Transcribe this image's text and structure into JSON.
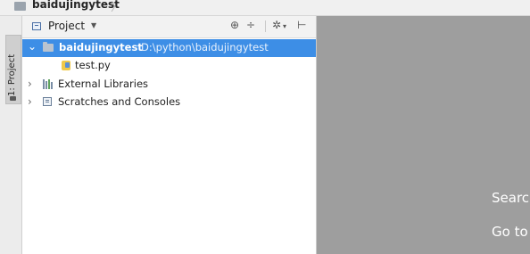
{
  "navbar": {
    "crumb": "baidujingytest"
  },
  "toolwindow_stripe": {
    "tab_label": "1: Project"
  },
  "project_panel": {
    "header": {
      "view_label": "Project"
    },
    "tree": [
      {
        "name": "baidujingytest",
        "path": "D:\\python\\baidujingytest",
        "expanded": true,
        "selected": true,
        "icon": "folder-icon"
      },
      {
        "name": "test.py",
        "icon": "python-file-icon"
      },
      {
        "name": "External Libraries",
        "expanded": false,
        "icon": "libraries-icon"
      },
      {
        "name": "Scratches and Consoles",
        "expanded": false,
        "icon": "scratches-icon"
      }
    ]
  },
  "editor": {
    "hint_search": "Searc",
    "hint_goto": "Go to"
  },
  "colors": {
    "selection": "#3d8ee6",
    "editor_background": "#9e9e9e",
    "panel_background": "#ffffff"
  }
}
